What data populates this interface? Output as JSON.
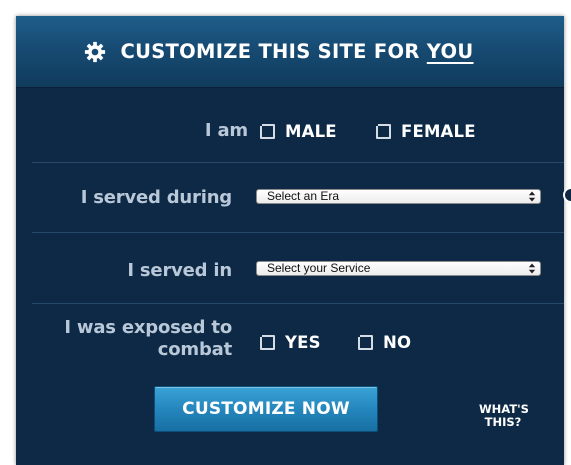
{
  "header": {
    "title_prefix": "CUSTOMIZE THIS SITE FOR",
    "title_emphasis": "YOU",
    "icon": "gear-icon"
  },
  "gender": {
    "label": "I am",
    "options": [
      {
        "label": "MALE",
        "checked": false
      },
      {
        "label": "FEMALE",
        "checked": false
      }
    ]
  },
  "era": {
    "label": "I served during",
    "selected": "Select an Era"
  },
  "service": {
    "label": "I served in",
    "selected": "Select your Service"
  },
  "combat": {
    "label_line1": "I was exposed to",
    "label_line2": "combat",
    "options": [
      {
        "label": "YES",
        "checked": false
      },
      {
        "label": "NO",
        "checked": false
      }
    ]
  },
  "actions": {
    "submit_label": "CUSTOMIZE NOW",
    "whats_this_line1": "WHAT'S",
    "whats_this_line2": "THIS?"
  },
  "colors": {
    "panel_background": "#0d2945",
    "header_background": "#174b73",
    "button_background": "#2587bd",
    "label_text": "#b9c8d8",
    "option_text": "#ffffff"
  }
}
